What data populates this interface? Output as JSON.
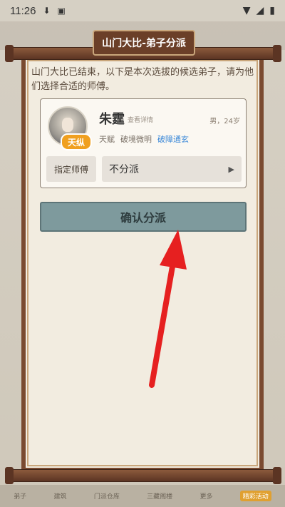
{
  "status_bar": {
    "time": "11:26"
  },
  "dialog": {
    "title": "山门大比-弟子分派",
    "intro": "山门大比已结束，以下是本次选拔的候选弟子，请为他们选择合适的师傅。"
  },
  "disciple": {
    "badge": "天纵",
    "name": "朱霆",
    "detail_link": "查看详情",
    "gender_age": "男，24岁",
    "traits": [
      "天赋",
      "破境微明",
      "破障通玄"
    ],
    "assign_label": "指定师傅",
    "assign_value": "不分派"
  },
  "confirm_label": "确认分派",
  "bottom_nav": [
    "弟子",
    "建筑",
    "门派仓库",
    "三藏阁楼",
    "更多",
    "精彩活动"
  ],
  "colors": {
    "arrow": "#e62020"
  }
}
